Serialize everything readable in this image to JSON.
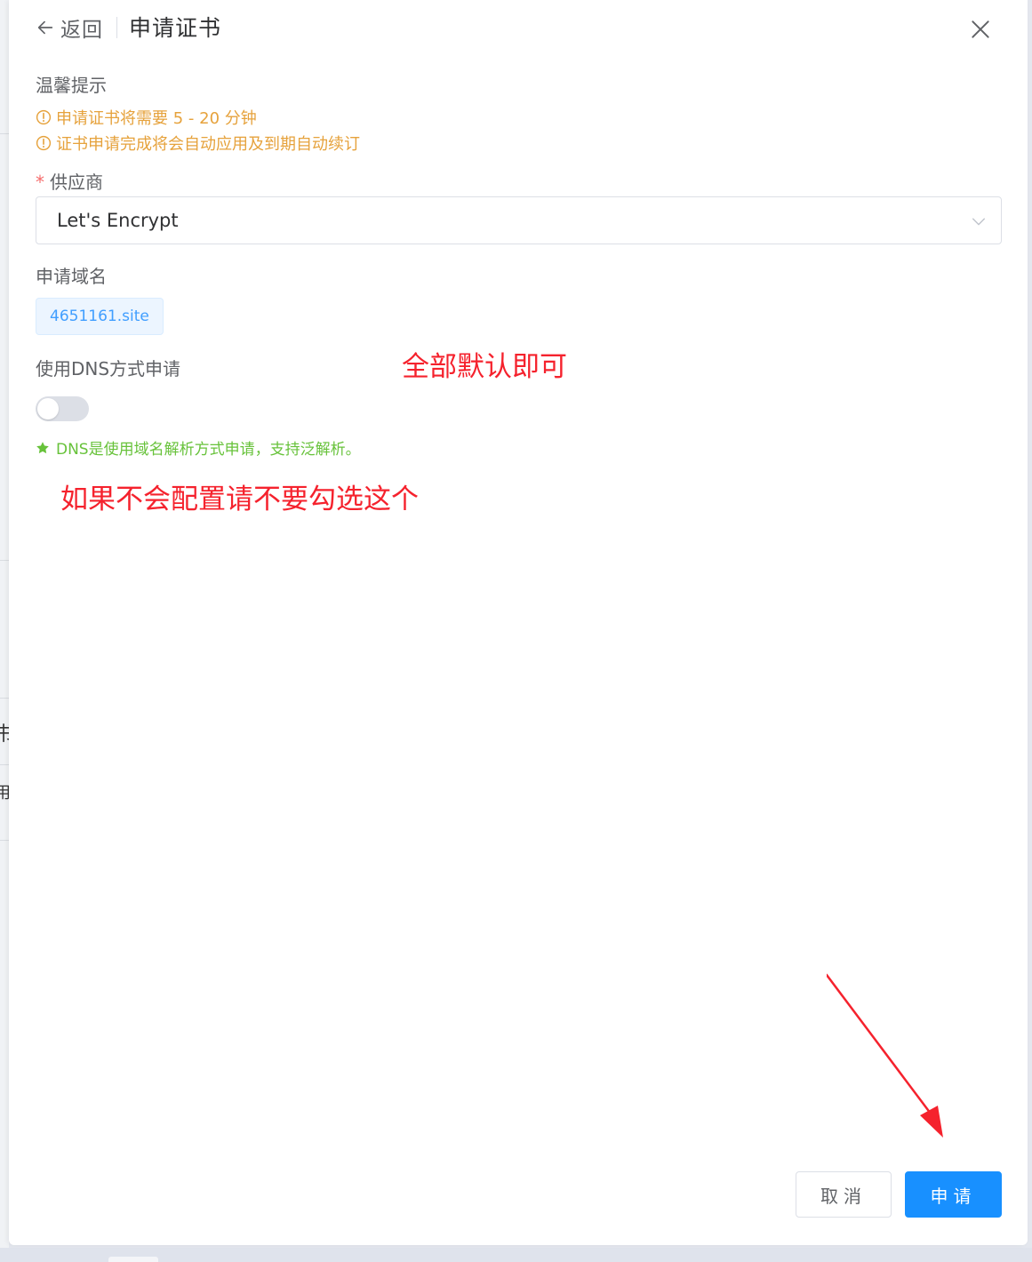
{
  "header": {
    "back_label": "返回",
    "title": "申请证书"
  },
  "tips": {
    "heading": "温馨提示",
    "items": [
      "申请证书将需要 5 - 20 分钟",
      "证书申请完成将会自动应用及到期自动续订"
    ]
  },
  "provider": {
    "required_mark": "*",
    "label": "供应商",
    "selected": "Let's Encrypt"
  },
  "domain": {
    "label": "申请域名",
    "tag": "4651161.site"
  },
  "dns": {
    "label": "使用DNS方式申请",
    "enabled": false,
    "hint": "DNS是使用域名解析方式申请，支持泛解析。"
  },
  "annotations": {
    "defaults_note": "全部默认即可",
    "dns_note": "如果不会配置请不要勾选这个"
  },
  "footer": {
    "cancel_label": "取消",
    "submit_label": "申请"
  },
  "background": {
    "fragments": [
      "书",
      "用"
    ]
  },
  "colors": {
    "primary": "#1890ff",
    "warning": "#e6a23c",
    "success": "#67c23a",
    "annotation": "#f5222d",
    "required": "#f56c6c"
  }
}
